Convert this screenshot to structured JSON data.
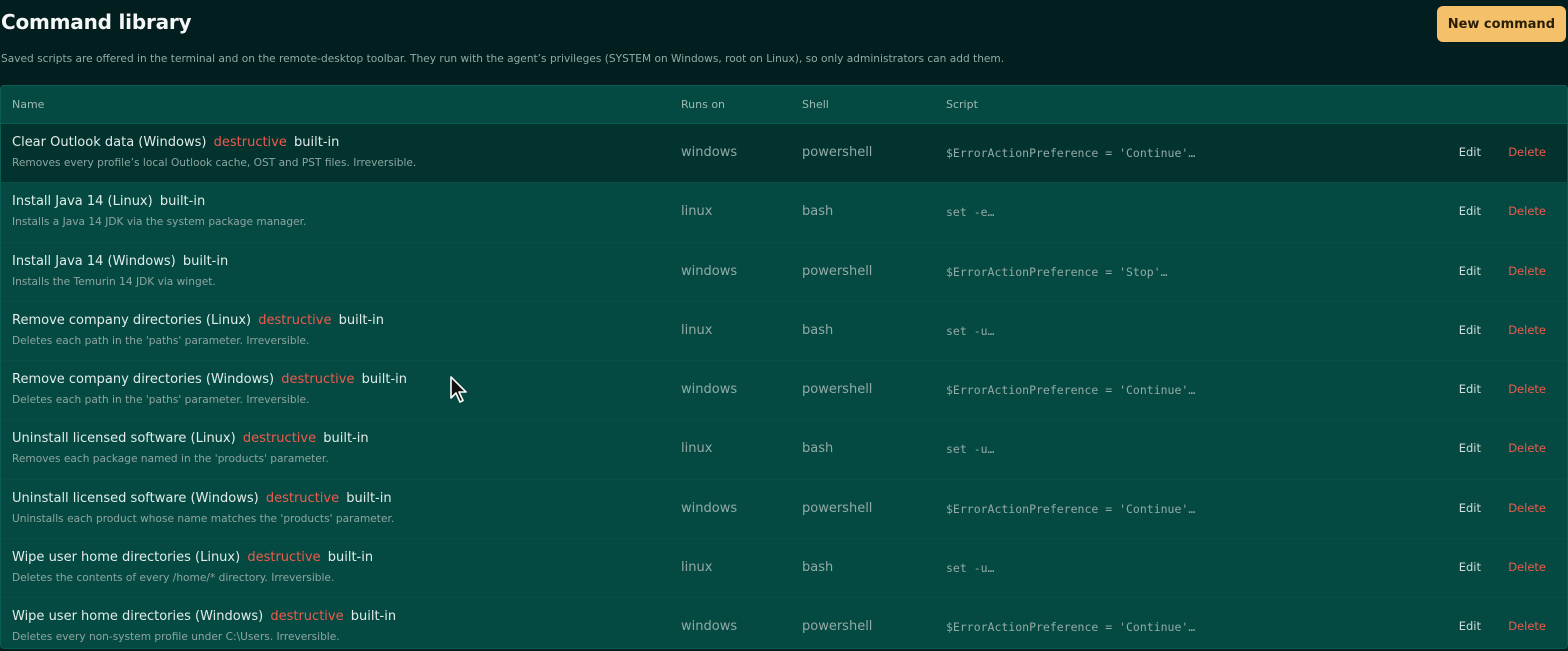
{
  "header": {
    "title": "Command library",
    "new_button": "New command",
    "subtitle": "Saved scripts are offered in the terminal and on the remote-desktop toolbar. They run with the agent’s privileges (SYSTEM on Windows, root on Linux), so only administrators can add them."
  },
  "table": {
    "columns": {
      "name": "Name",
      "runs_on": "Runs on",
      "shell": "Shell",
      "script": "Script"
    },
    "rows": [
      {
        "name": "Clear Outlook data (Windows)",
        "destructive": "destructive",
        "builtin": "built-in",
        "description": "Removes every profile’s local Outlook cache, OST and PST files. Irreversible.",
        "runs_on": "windows",
        "shell": "powershell",
        "script": "$ErrorActionPreference = 'Continue'…",
        "edit": "Edit",
        "delete": "Delete"
      },
      {
        "name": "Install Java 14 (Linux)",
        "destructive": null,
        "builtin": "built-in",
        "description": "Installs a Java 14 JDK via the system package manager.",
        "runs_on": "linux",
        "shell": "bash",
        "script": "set -e…",
        "edit": "Edit",
        "delete": "Delete"
      },
      {
        "name": "Install Java 14 (Windows)",
        "destructive": null,
        "builtin": "built-in",
        "description": "Installs the Temurin 14 JDK via winget.",
        "runs_on": "windows",
        "shell": "powershell",
        "script": "$ErrorActionPreference = 'Stop'…",
        "edit": "Edit",
        "delete": "Delete"
      },
      {
        "name": "Remove company directories (Linux)",
        "destructive": "destructive",
        "builtin": "built-in",
        "description": "Deletes each path in the 'paths' parameter. Irreversible.",
        "runs_on": "linux",
        "shell": "bash",
        "script": "set -u…",
        "edit": "Edit",
        "delete": "Delete"
      },
      {
        "name": "Remove company directories (Windows)",
        "destructive": "destructive",
        "builtin": "built-in",
        "description": "Deletes each path in the 'paths' parameter. Irreversible.",
        "runs_on": "windows",
        "shell": "powershell",
        "script": "$ErrorActionPreference = 'Continue'…",
        "edit": "Edit",
        "delete": "Delete"
      },
      {
        "name": "Uninstall licensed software (Linux)",
        "destructive": "destructive",
        "builtin": "built-in",
        "description": "Removes each package named in the 'products' parameter.",
        "runs_on": "linux",
        "shell": "bash",
        "script": "set -u…",
        "edit": "Edit",
        "delete": "Delete"
      },
      {
        "name": "Uninstall licensed software (Windows)",
        "destructive": "destructive",
        "builtin": "built-in",
        "description": "Uninstalls each product whose name matches the 'products' parameter.",
        "runs_on": "windows",
        "shell": "powershell",
        "script": "$ErrorActionPreference = 'Continue'…",
        "edit": "Edit",
        "delete": "Delete"
      },
      {
        "name": "Wipe user home directories (Linux)",
        "destructive": "destructive",
        "builtin": "built-in",
        "description": "Deletes the contents of every /home/* directory. Irreversible.",
        "runs_on": "linux",
        "shell": "bash",
        "script": "set -u…",
        "edit": "Edit",
        "delete": "Delete"
      },
      {
        "name": "Wipe user home directories (Windows)",
        "destructive": "destructive",
        "builtin": "built-in",
        "description": "Deletes every non-system profile under C:\\Users. Irreversible.",
        "runs_on": "windows",
        "shell": "powershell",
        "script": "$ErrorActionPreference = 'Continue'…",
        "edit": "Edit",
        "delete": "Delete"
      }
    ]
  },
  "colors": {
    "background": "#021e1e",
    "table_background": "#044a42",
    "accent_button": "#f5c06a",
    "destructive": "#ef5a4c"
  },
  "icons": {
    "cursor": "mouse-pointer-icon"
  }
}
